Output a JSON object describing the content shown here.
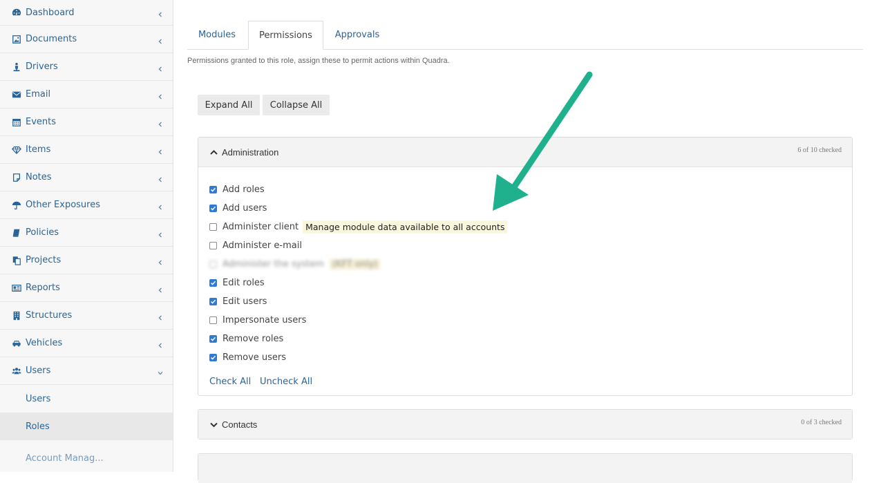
{
  "sidebar": {
    "items": [
      {
        "label": "Dashboard",
        "icon": "dashboard-icon"
      },
      {
        "label": "Documents",
        "icon": "image-icon"
      },
      {
        "label": "Drivers",
        "icon": "driver-icon"
      },
      {
        "label": "Email",
        "icon": "envelope-icon"
      },
      {
        "label": "Events",
        "icon": "calendar-icon"
      },
      {
        "label": "Items",
        "icon": "diamond-icon"
      },
      {
        "label": "Notes",
        "icon": "note-icon"
      },
      {
        "label": "Other Exposures",
        "icon": "umbrella-icon"
      },
      {
        "label": "Policies",
        "icon": "book-icon"
      },
      {
        "label": "Projects",
        "icon": "copy-icon"
      },
      {
        "label": "Reports",
        "icon": "newspaper-icon"
      },
      {
        "label": "Structures",
        "icon": "building-icon"
      },
      {
        "label": "Vehicles",
        "icon": "car-icon"
      },
      {
        "label": "Users",
        "icon": "users-icon"
      }
    ],
    "users_subitems": [
      {
        "label": "Users"
      },
      {
        "label": "Roles"
      },
      {
        "label": "Account Manag..."
      }
    ]
  },
  "tabs": [
    {
      "label": "Modules"
    },
    {
      "label": "Permissions"
    },
    {
      "label": "Approvals"
    }
  ],
  "description": "Permissions granted to this role, assign these to permit actions within Quadra.",
  "buttons": {
    "expand_all": "Expand All",
    "collapse_all": "Collapse All"
  },
  "panels": {
    "administration": {
      "title": "Administration",
      "count": "6 of 10 checked",
      "permissions": [
        {
          "label": "Add roles",
          "checked": true
        },
        {
          "label": "Add users",
          "checked": true
        },
        {
          "label": "Administer client",
          "checked": false,
          "tooltip": "Manage module data available to all accounts"
        },
        {
          "label": "Administer e-mail",
          "checked": false
        },
        {
          "label": "Administer the system",
          "checked": false,
          "tag": "(KFT only)"
        },
        {
          "label": "Edit roles",
          "checked": true
        },
        {
          "label": "Edit users",
          "checked": true
        },
        {
          "label": "Impersonate users",
          "checked": false
        },
        {
          "label": "Remove roles",
          "checked": true
        },
        {
          "label": "Remove users",
          "checked": true
        }
      ],
      "check_all": "Check All",
      "uncheck_all": "Uncheck All"
    },
    "contacts": {
      "title": "Contacts",
      "count": "0 of 3 checked"
    }
  },
  "colors": {
    "link": "#2a6496",
    "checkbox_checked": "#2f7bd4",
    "arrow": "#1fb08e",
    "tooltip_bg": "#fbf7dc"
  }
}
